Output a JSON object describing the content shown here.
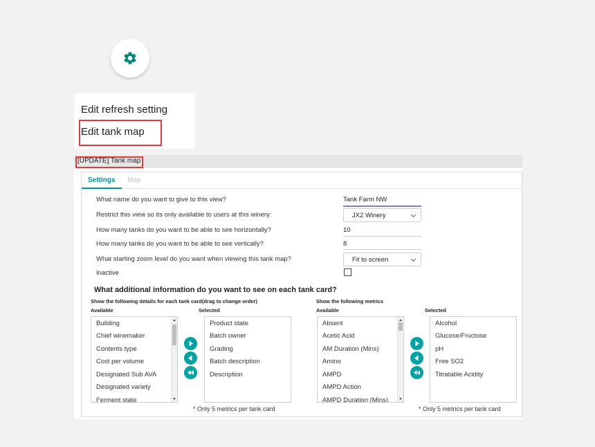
{
  "colors": {
    "accent": "#00939c",
    "highlight": "#e03c3c",
    "arrow": "#00a3a3"
  },
  "gear_button": {
    "icon": "gear-icon"
  },
  "menu": {
    "items": [
      "Edit refresh setting",
      "Edit tank map"
    ]
  },
  "dialog": {
    "title": "[UPDATE] Tank map",
    "tabs": [
      "Settings",
      "Map"
    ],
    "questions": {
      "name": "What name do you want to give to this view?",
      "restrict": "Restrict this view so its only available to users at this winery:",
      "horizontal": "How many tanks do you want to be able to see horizontally?",
      "vertical": "How many tanks do you want to be able to see vertically?",
      "zoom": "What starting zoom level do you want when viewing this tank map?",
      "inactive": "Inactive"
    },
    "values": {
      "name": "Tank Farm NW",
      "winery": "JX2 Winery",
      "horizontal": "10",
      "vertical": "8",
      "zoom": "Fit to screen"
    },
    "additional_heading": "What additional information do you want to see on each tank card?",
    "details": {
      "heading": "Show the following details for each tank card(drag to change order)",
      "available_label": "Available",
      "selected_label": "Selected",
      "available": [
        "Building",
        "Chief winemaker",
        "Contents type",
        "Cost per volume",
        "Designated Sub AVA",
        "Designated variety",
        "Ferment state"
      ],
      "selected": [
        "Product state",
        "Batch owner",
        "Grading",
        "Batch description",
        "Description"
      ],
      "note": "* Only 5 metrics per tank card"
    },
    "metrics": {
      "heading": "Show the following metrics",
      "available_label": "Available",
      "selected_label": "Selected",
      "available": [
        "Absent",
        "Acetic Acid",
        "AM Duration (Mins)",
        "Amino",
        "AMPD",
        "AMPD Action",
        "AMPD Duration (Mins)"
      ],
      "selected": [
        "Alcohol",
        "Glucose/Fructose",
        "pH",
        "Free SO2",
        "Titratable Acidity"
      ],
      "note": "* Only 5 metrics per tank card"
    }
  }
}
